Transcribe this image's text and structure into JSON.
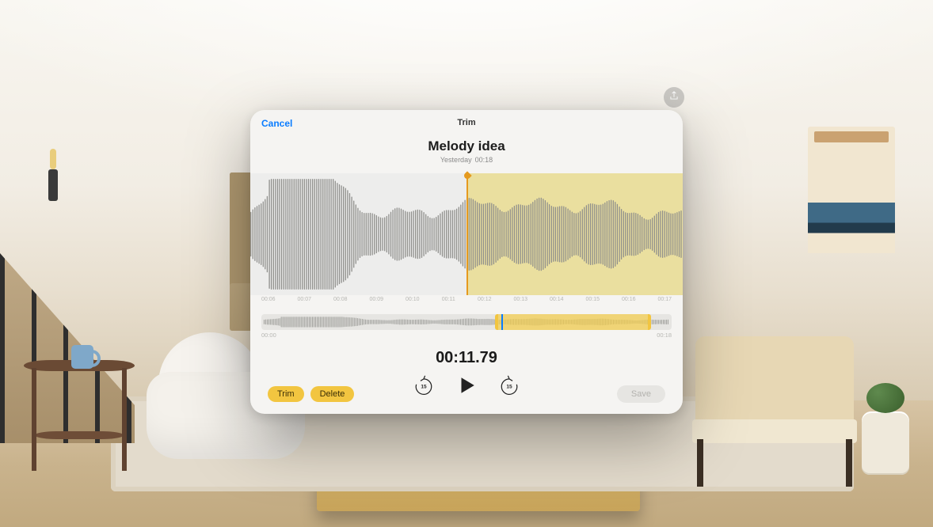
{
  "modal": {
    "header_title": "Trim",
    "cancel_label": "Cancel",
    "recording_title": "Melody idea",
    "recording_date": "Yesterday",
    "recording_duration": "00:18"
  },
  "timeline_ticks": [
    "00:06",
    "00:07",
    "00:08",
    "00:09",
    "00:10",
    "00:11",
    "00:12",
    "00:13",
    "00:14",
    "00:15",
    "00:16",
    "00:17"
  ],
  "scrubber": {
    "start_label": "00:00",
    "end_label": "00:18",
    "selection_start_pct": 57,
    "selection_end_pct": 95,
    "playhead_pct": 58.5
  },
  "current_time": "00:11.79",
  "buttons": {
    "trim": "Trim",
    "delete": "Delete",
    "save": "Save",
    "skip_amount": "15"
  },
  "colors": {
    "accent_blue": "#0a7cff",
    "accent_yellow": "#f2c540",
    "playhead_orange": "#e59a1f"
  }
}
